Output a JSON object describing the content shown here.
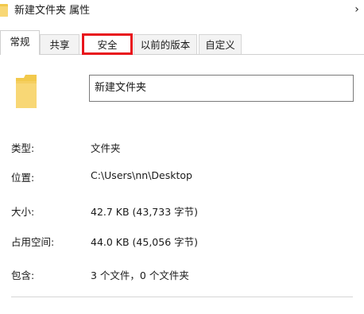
{
  "window": {
    "title": "新建文件夹 属性",
    "close_glyph": "›",
    "title_icon": "folder-icon"
  },
  "tabs": [
    {
      "label": "常规",
      "state": "active"
    },
    {
      "label": "共享",
      "state": "normal"
    },
    {
      "label": "安全",
      "state": "highlighted"
    },
    {
      "label": "以前的版本",
      "state": "normal"
    },
    {
      "label": "自定义",
      "state": "normal"
    }
  ],
  "folder": {
    "icon": "folder-icon",
    "name": "新建文件夹"
  },
  "properties": [
    {
      "label": "类型:",
      "value": "文件夹"
    },
    {
      "label": "位置:",
      "value": "C:\\Users\\nn\\Desktop"
    },
    {
      "label": "大小:",
      "value": "42.7 KB (43,733 字节)"
    },
    {
      "label": "占用空间:",
      "value": "44.0 KB (45,056 字节)"
    },
    {
      "label": "包含:",
      "value": "3 个文件，0 个文件夹"
    }
  ],
  "colors": {
    "folder_yellow": "#f2c94c",
    "folder_light": "#f8d775",
    "highlight_red": "#e8141b"
  }
}
